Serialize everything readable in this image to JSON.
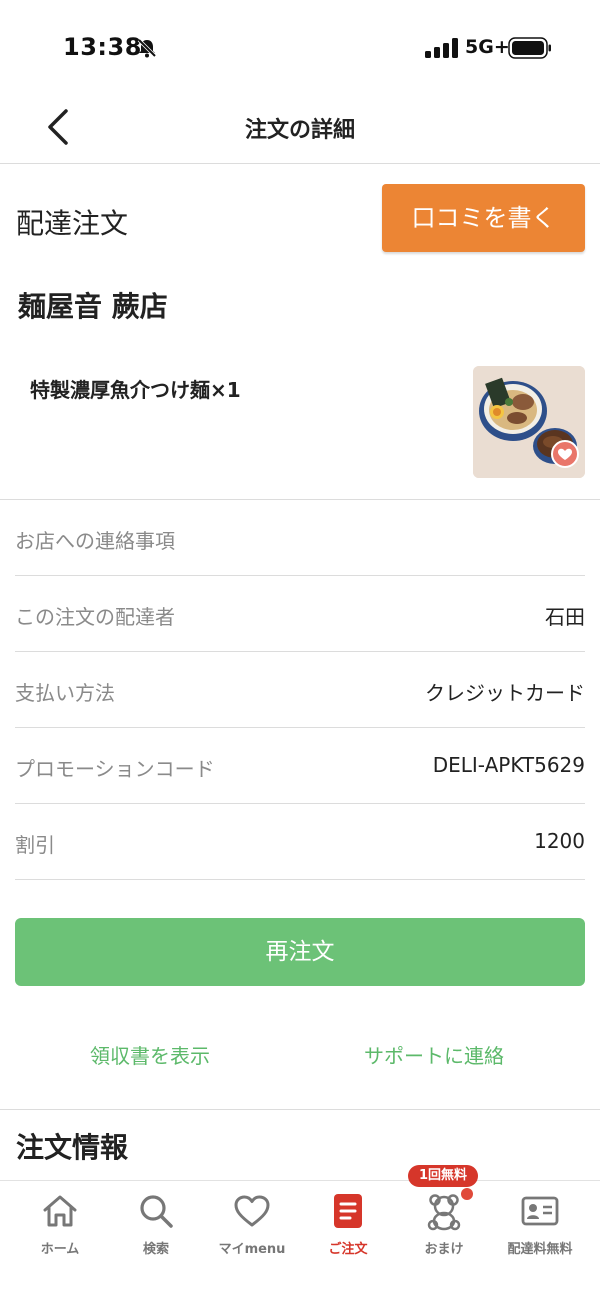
{
  "status_bar": {
    "time": "13:38",
    "network": "5G+"
  },
  "header": {
    "title": "注文の詳細"
  },
  "order": {
    "type_label": "配達注文",
    "review_button": "口コミを書く",
    "shop_name": "麺屋音 蕨店",
    "item": "特製濃厚魚介つけ麺×1"
  },
  "details": [
    {
      "label": "お店への連絡事項",
      "value": ""
    },
    {
      "label": "この注文の配達者",
      "value": "石田"
    },
    {
      "label": "支払い方法",
      "value": "クレジットカード"
    },
    {
      "label": "プロモーションコード",
      "value": "DELI-APKT5629"
    },
    {
      "label": "割引",
      "value": "1200"
    }
  ],
  "actions": {
    "reorder": "再注文",
    "receipt": "領収書を表示",
    "support": "サポートに連絡"
  },
  "section": {
    "order_info_title": "注文情報"
  },
  "tab_bar": {
    "promo_badge": "1回無料",
    "tabs": [
      {
        "label": "ホーム",
        "icon": "home-icon"
      },
      {
        "label": "検索",
        "icon": "search-icon"
      },
      {
        "label": "マイmenu",
        "icon": "heart-icon"
      },
      {
        "label": "ご注文",
        "icon": "order-icon"
      },
      {
        "label": "おまけ",
        "icon": "bear-icon"
      },
      {
        "label": "配達料無料",
        "icon": "id-card-icon"
      }
    ]
  },
  "colors": {
    "accent_orange": "#ec8534",
    "reorder_green": "#6cc277",
    "link_green": "#5cb96a",
    "active_red": "#d6362a"
  }
}
